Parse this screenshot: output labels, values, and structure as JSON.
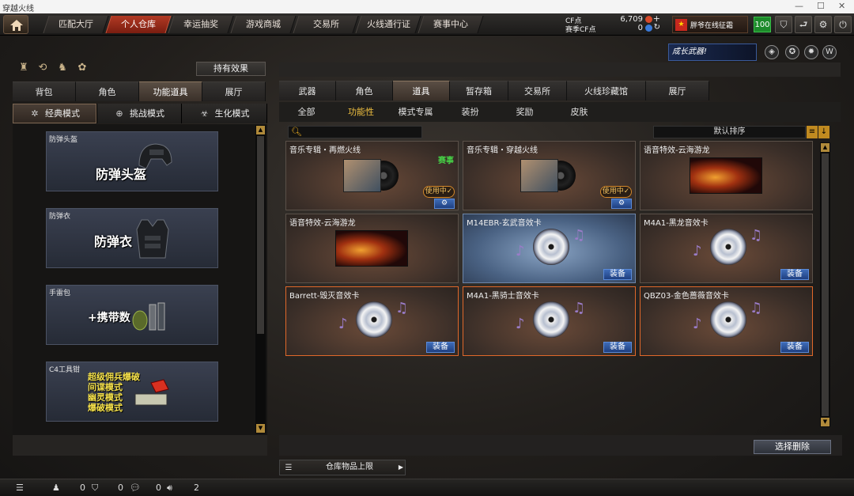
{
  "window": {
    "title": "穿越火线"
  },
  "nav": {
    "tabs": [
      "匹配大厅",
      "个人仓库",
      "幸运抽奖",
      "游戏商城",
      "交易所",
      "火线通行证",
      "赛事中心"
    ],
    "active": "个人仓库"
  },
  "currency": {
    "cf_label": "CF点",
    "cf_value": "6,709",
    "season_label": "赛季CF点",
    "season_value": "0"
  },
  "user": {
    "name": "胖爷在线征霜",
    "level": "100"
  },
  "left": {
    "hold_effect_label": "持有效果",
    "tabs": [
      "背包",
      "角色",
      "功能道具",
      "展厅"
    ],
    "active_tab": "功能道具",
    "modes": [
      {
        "label": "经典模式",
        "icon": "crosshair-icon"
      },
      {
        "label": "挑战模式",
        "icon": "target-icon"
      },
      {
        "label": "生化模式",
        "icon": "biohazard-icon"
      }
    ],
    "active_mode": "经典模式",
    "categories": [
      {
        "caption": "防弹头盔",
        "title": "防弹头盔"
      },
      {
        "caption": "防弹衣",
        "title": "防弹衣"
      },
      {
        "caption": "手雷包",
        "title": "+携带数"
      },
      {
        "caption": "C4工具钳",
        "title": "超级佣兵爆破",
        "lines": [
          "间谍模式",
          "幽灵模式",
          "爆破模式"
        ]
      }
    ]
  },
  "right": {
    "banner": "成长武器!",
    "tabs": [
      "武器",
      "角色",
      "道具",
      "暂存箱",
      "交易所",
      "火线珍藏馆",
      "展厅"
    ],
    "active_tab": "道具",
    "subtabs": [
      "全部",
      "功能性",
      "模式专属",
      "装扮",
      "奖励",
      "皮肤"
    ],
    "active_subtab": "功能性",
    "sort_label": "默认排序",
    "items": [
      {
        "name": "音乐专辑・再燃火线",
        "kind": "album",
        "match_tag": "赛事",
        "in_use": "使用中✓"
      },
      {
        "name": "音乐专辑・穿越火线",
        "kind": "album",
        "in_use": "使用中✓"
      },
      {
        "name": "语音特效-云海游龙",
        "kind": "dragon"
      },
      {
        "name": "语音特效-云海游龙",
        "kind": "dragon"
      },
      {
        "name": "M14EBR-玄武音效卡",
        "kind": "disc",
        "equip": "装备"
      },
      {
        "name": "M4A1-黑龙音效卡",
        "kind": "disc",
        "equip": "装备"
      },
      {
        "name": "Barrett-毁灭音效卡",
        "kind": "disc",
        "equip": "装备"
      },
      {
        "name": "M4A1-黑骑士音效卡",
        "kind": "disc",
        "equip": "装备"
      },
      {
        "name": "QBZ03-金色蔷薇音效卡",
        "kind": "disc",
        "equip": "装备"
      }
    ],
    "delete_label": "选择删除",
    "capacity_label": "仓库物品上限"
  },
  "status": {
    "friends": "0",
    "teams": "0",
    "chat": "0",
    "volume": "2"
  }
}
